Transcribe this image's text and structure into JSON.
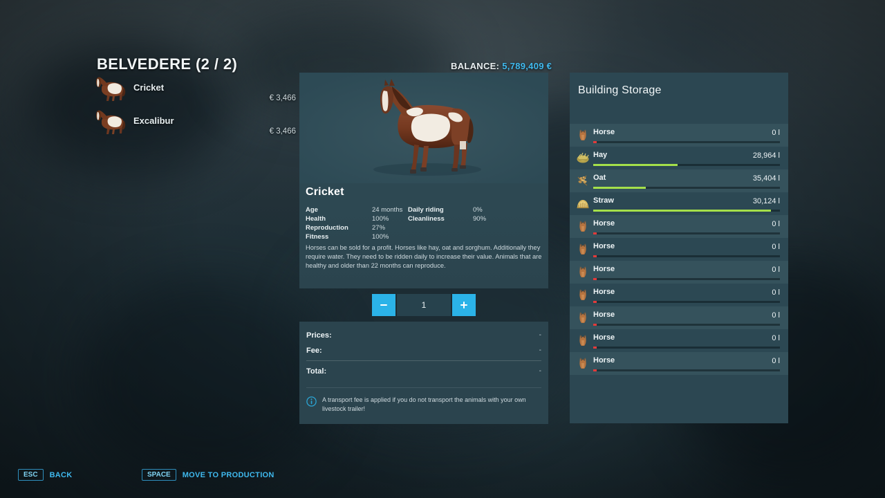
{
  "header": {
    "farm_title": "BELVEDERE (2 / 2)",
    "balance_label": "BALANCE:",
    "balance_amount": "5,789,409 €"
  },
  "animal_list": [
    {
      "name": "Cricket",
      "price": "€ 3,466",
      "icon": "horse-thumb-icon"
    },
    {
      "name": "Excalibur",
      "price": "€ 3,466",
      "icon": "horse-thumb-icon"
    }
  ],
  "detail": {
    "name": "Cricket",
    "stats": [
      {
        "key": "Age",
        "value": "24 months",
        "col": 0,
        "row": 0
      },
      {
        "key": "Health",
        "value": "100%",
        "col": 0,
        "row": 1
      },
      {
        "key": "Reproduction",
        "value": "27%",
        "col": 0,
        "row": 2
      },
      {
        "key": "Fitness",
        "value": "100%",
        "col": 0,
        "row": 3
      },
      {
        "key": "Daily riding",
        "value": "0%",
        "col": 1,
        "row": 0
      },
      {
        "key": "Cleanliness",
        "value": "90%",
        "col": 1,
        "row": 1
      }
    ],
    "description": "Horses can be sold for a profit. Horses like hay, oat and sorghum. Additionally they require water. They need to be ridden daily to increase their value. Animals that are healthy and older than 22 months can reproduce."
  },
  "stepper": {
    "decrement_label": "minus-icon",
    "value": "1",
    "increment_label": "plus-icon"
  },
  "prices": {
    "rows": [
      {
        "label": "Prices:",
        "value": "-"
      },
      {
        "label": "Fee:",
        "value": "-"
      },
      {
        "label": "Total:",
        "value": "-"
      }
    ],
    "note": "A transport fee is applied if you do not transport the animals with your own livestock trailer!"
  },
  "storage": {
    "title": "Building Storage",
    "rows": [
      {
        "label": "Horse",
        "value": "0 l",
        "fill": 2,
        "empty": true,
        "icon": "horse-icon"
      },
      {
        "label": "Hay",
        "value": "28,964 l",
        "fill": 45,
        "empty": false,
        "icon": "hay-icon"
      },
      {
        "label": "Oat",
        "value": "35,404 l",
        "fill": 28,
        "empty": false,
        "icon": "oat-icon"
      },
      {
        "label": "Straw",
        "value": "30,124 l",
        "fill": 95,
        "empty": false,
        "icon": "straw-icon"
      },
      {
        "label": "Horse",
        "value": "0 l",
        "fill": 2,
        "empty": true,
        "icon": "horse-icon"
      },
      {
        "label": "Horse",
        "value": "0 l",
        "fill": 2,
        "empty": true,
        "icon": "horse-icon"
      },
      {
        "label": "Horse",
        "value": "0 l",
        "fill": 2,
        "empty": true,
        "icon": "horse-icon"
      },
      {
        "label": "Horse",
        "value": "0 l",
        "fill": 2,
        "empty": true,
        "icon": "horse-icon"
      },
      {
        "label": "Horse",
        "value": "0 l",
        "fill": 2,
        "empty": true,
        "icon": "horse-icon"
      },
      {
        "label": "Horse",
        "value": "0 l",
        "fill": 2,
        "empty": true,
        "icon": "horse-icon"
      },
      {
        "label": "Horse",
        "value": "0 l",
        "fill": 2,
        "empty": true,
        "icon": "horse-icon"
      }
    ]
  },
  "help": [
    {
      "key": "ESC",
      "label": "BACK"
    },
    {
      "key": "SPACE",
      "label": "MOVE TO PRODUCTION"
    }
  ],
  "colors": {
    "accent": "#3fb9ee",
    "bar_fill": "#a5e04a",
    "bar_empty": "#e33a3a",
    "panel": "#2b444e",
    "stepper_button": "#2bb3e8"
  }
}
